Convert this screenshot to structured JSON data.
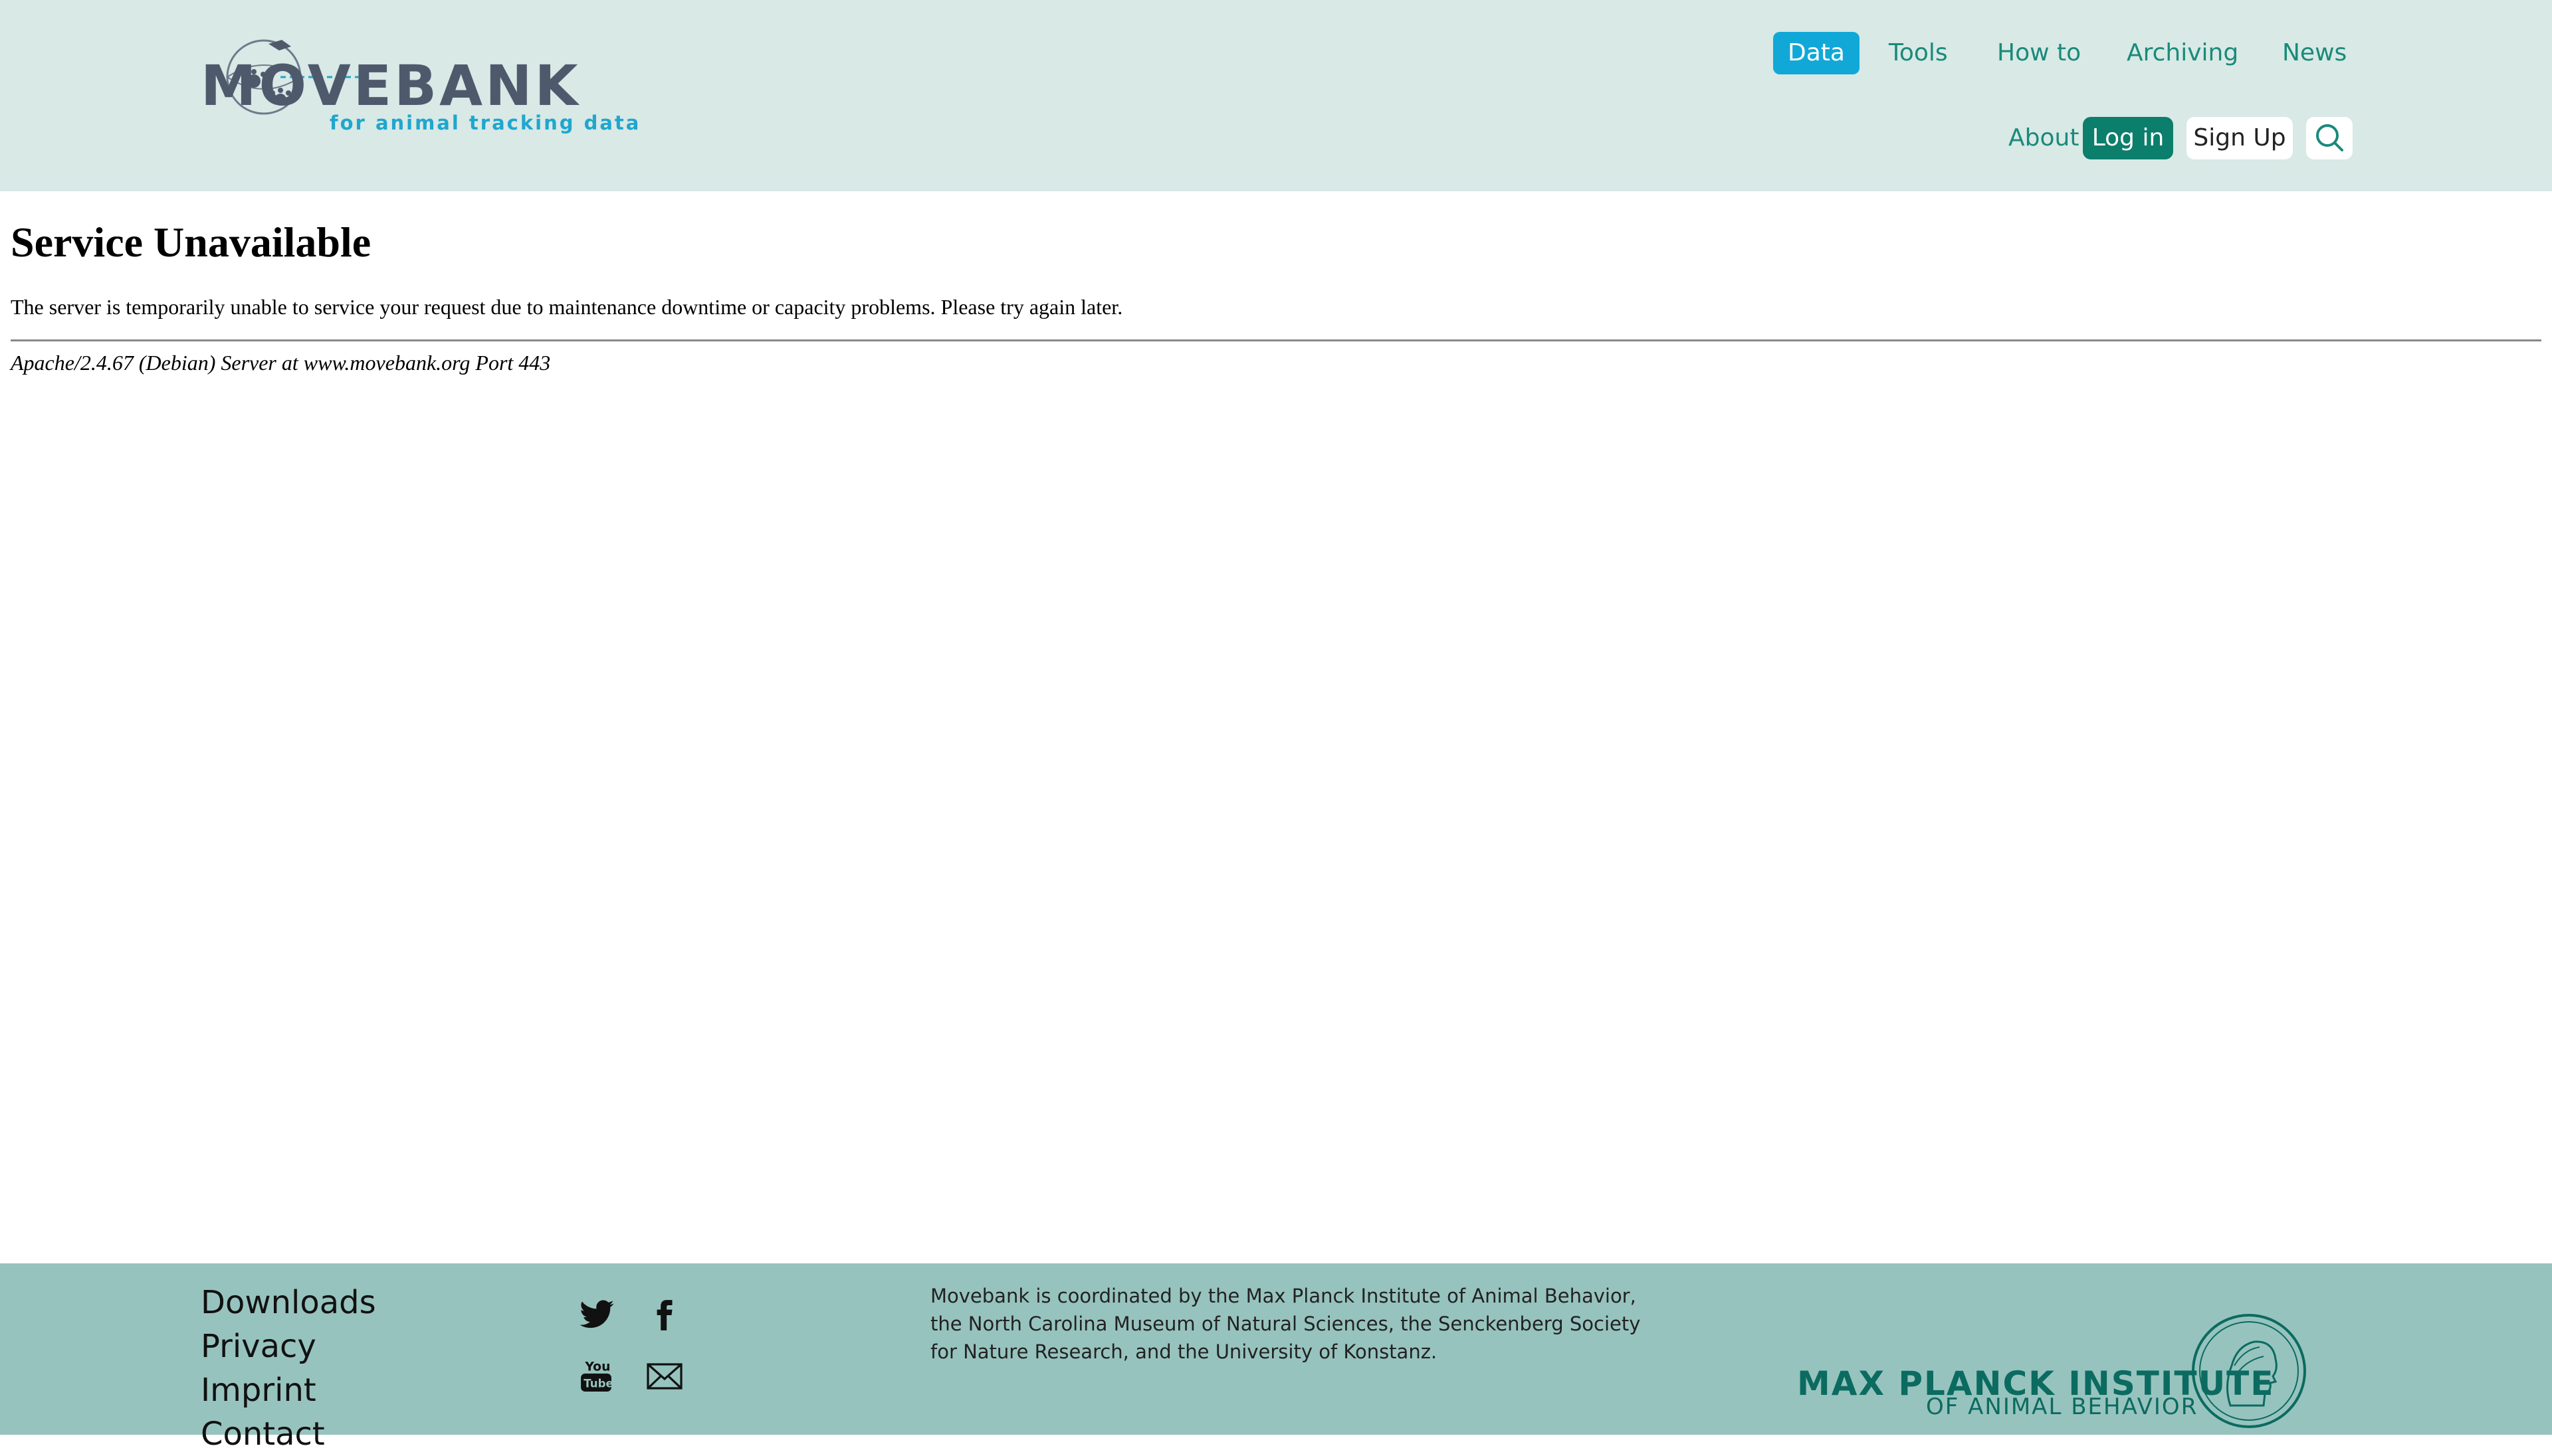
{
  "header": {
    "logo": {
      "word": "MOVEBANK",
      "tagline": "for animal tracking data"
    },
    "nav_top": [
      {
        "label": "Data",
        "active": true
      },
      {
        "label": "Tools"
      },
      {
        "label": "How to"
      },
      {
        "label": "Archiving"
      },
      {
        "label": "News"
      }
    ],
    "nav_bottom": {
      "about": "About",
      "login": "Log in",
      "signup": "Sign Up",
      "search_icon": "search-icon"
    }
  },
  "main": {
    "title": "Service Unavailable",
    "message": "The server is temporarily unable to service your request due to maintenance downtime or capacity problems. Please try again later.",
    "server_signature": "Apache/2.4.67 (Debian) Server at www.movebank.org Port 443"
  },
  "footer": {
    "links": [
      "Downloads",
      "Privacy",
      "Imprint",
      "Contact"
    ],
    "social": [
      "twitter-icon",
      "facebook-icon",
      "youtube-icon",
      "mail-icon"
    ],
    "coordination_text": "Movebank is coordinated by the Max Planck Institute of Animal Behavior, the North Carolina Museum of Natural Sciences, the Senckenberg Society for Nature Research, and the University of Konstanz.",
    "institute_name": "MAX PLANCK INSTITUTE",
    "institute_sub": "OF ANIMAL BEHAVIOR"
  },
  "colors": {
    "header_bg": "#d8e9e6",
    "footer_bg": "#97c3be",
    "accent_teal": "#0b7e6c",
    "accent_blue": "#11a8d8",
    "logo_gray": "#4e5a6c"
  }
}
